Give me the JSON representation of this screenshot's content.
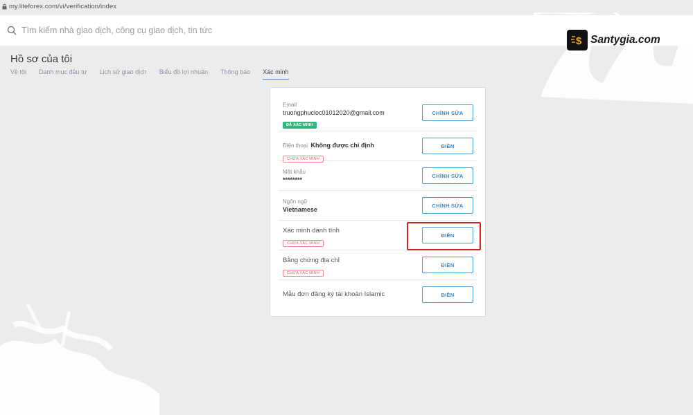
{
  "browser": {
    "url": "my.liteforex.com/vi/verification/index"
  },
  "search": {
    "placeholder": "Tìm kiếm nhà giao dịch, công cụ giao dịch, tin tức"
  },
  "page": {
    "title": "Hồ sơ của tôi"
  },
  "tabs": [
    {
      "label": "Về tôi",
      "active": false
    },
    {
      "label": "Danh mục đầu tư",
      "active": false
    },
    {
      "label": "Lịch sử giao dịch",
      "active": false
    },
    {
      "label": "Biểu đồ lợi nhuận",
      "active": false
    },
    {
      "label": "Thông báo",
      "active": false
    },
    {
      "label": "Xác minh",
      "active": true
    }
  ],
  "verification": {
    "rows": [
      {
        "label": "Email",
        "value": "truongphucloc01012020@gmail.com",
        "badge": "ĐÃ XÁC MINH",
        "button": "CHỈNH SỬA"
      },
      {
        "label": "Điện thoại",
        "value": "Không được chỉ định",
        "badge": "CHƯA XÁC MINH",
        "button": "ĐIỀN"
      },
      {
        "label": "Mật khẩu",
        "value": "********",
        "button": "CHỈNH SỬA"
      },
      {
        "label": "Ngôn ngữ",
        "value": "Vietnamese",
        "button": "CHỈNH SỬA"
      },
      {
        "label": "Xác minh danh tính",
        "badge": "CHƯA XÁC MINH",
        "button": "ĐIỀN"
      },
      {
        "label": "Bằng chứng địa chỉ",
        "badge": "CHƯA XÁC MINH",
        "button": "ĐIỀN"
      },
      {
        "label": "Mẫu đơn đăng ký tài khoản Islamic",
        "button": "ĐIỀN"
      }
    ]
  },
  "watermark": {
    "text": "Santygia.com",
    "icon": "dollar-lightning-icon"
  },
  "colors": {
    "accent": "#3b88c6",
    "verified": "#36b37e",
    "unverified": "#e05858",
    "highlight": "#d42020"
  }
}
